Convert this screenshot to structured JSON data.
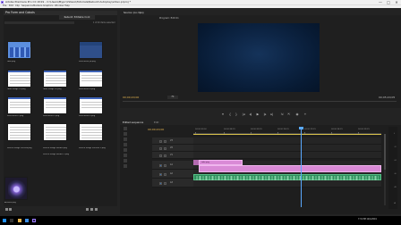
{
  "window": {
    "title": "Adobe Premiere Pro CC 2019 - C:\\Users\\Mypc\\Videos\\Tutorials\\Rebuild Autoplay\\video.prproj *",
    "controls": [
      "—",
      "□",
      "✕"
    ]
  },
  "menu": [
    "File",
    "Edit",
    "Clip",
    "Sequence",
    "Markers",
    "Graphics",
    "Window",
    "Help"
  ],
  "project_panel": {
    "tab": "Pro Form and Cobols",
    "bin_tab": "Rebuild: Editable Cont",
    "item_count": "1 of 20 items selected",
    "items": [
      {
        "label": "tabs.png",
        "kind": "blue"
      },
      {
        "label": "Screenshot_A.png",
        "kind": "dark"
      },
      {
        "label": "Table image 01.png",
        "kind": "table"
      },
      {
        "label": "Table image 02.png",
        "kind": "table"
      },
      {
        "label": "Screenshot 1.png",
        "kind": "table"
      },
      {
        "label": "Screenshot 2.png",
        "kind": "table"
      },
      {
        "label": "Screenshot 3.png",
        "kind": "table"
      },
      {
        "label": "Screenshot 4.png",
        "kind": "table"
      },
      {
        "label": "Screen Image Preview.png",
        "kind": "doc"
      },
      {
        "label": "Screen Image Render.png",
        "kind": "doc"
      },
      {
        "label": "Screen Image Preview 2.png",
        "kind": "doc"
      },
      {
        "label": "Screen Image Render 2.png",
        "kind": "doc"
      },
      {
        "label": "Artwork.png",
        "kind": "purple"
      }
    ]
  },
  "source_panel": {
    "tab": "Source: (no clips)"
  },
  "program_panel": {
    "tab": "Program: Edit 01",
    "timecode_left": "00;00;20;00",
    "timecode_right": "00;05;20;05",
    "fit": "Fit"
  },
  "transport": {
    "buttons": [
      "marker",
      "in",
      "out",
      "go-in",
      "step-back",
      "play",
      "step-fwd",
      "go-out",
      "insert",
      "overwrite",
      "export-frame",
      "settings"
    ],
    "glyphs": [
      "▾",
      "{",
      "}",
      "|◂",
      "◂|",
      "▶",
      "|▸",
      "▸|",
      "⇲",
      "⇱",
      "◉",
      "+"
    ]
  },
  "timeline": {
    "tab": "Edited sequence",
    "tab_alt": "Edit",
    "timecode": "00;00;20;00",
    "ruler_labels": [
      "00;00;00;00",
      "00;00;04;29",
      "00;00;09;29",
      "00;00;14;29",
      "00;00;19;29",
      "00;00;24;29",
      "00;00;29;29"
    ],
    "tracks": [
      "V3",
      "V2",
      "V1",
      "A1",
      "A2",
      "A3"
    ],
    "clip_label": "tabs.png"
  },
  "meter": {
    "labels": [
      "0",
      "-12",
      "-24",
      "-36",
      "-48",
      "dB"
    ]
  },
  "tray": {
    "time": "7:31 PM",
    "date": "12/1/2019"
  },
  "colors": {
    "timecode": "#e8b64f",
    "playhead": "#5aa9ff",
    "video_clip": "#d98ad6",
    "audio_clip": "#2e8f5c"
  }
}
